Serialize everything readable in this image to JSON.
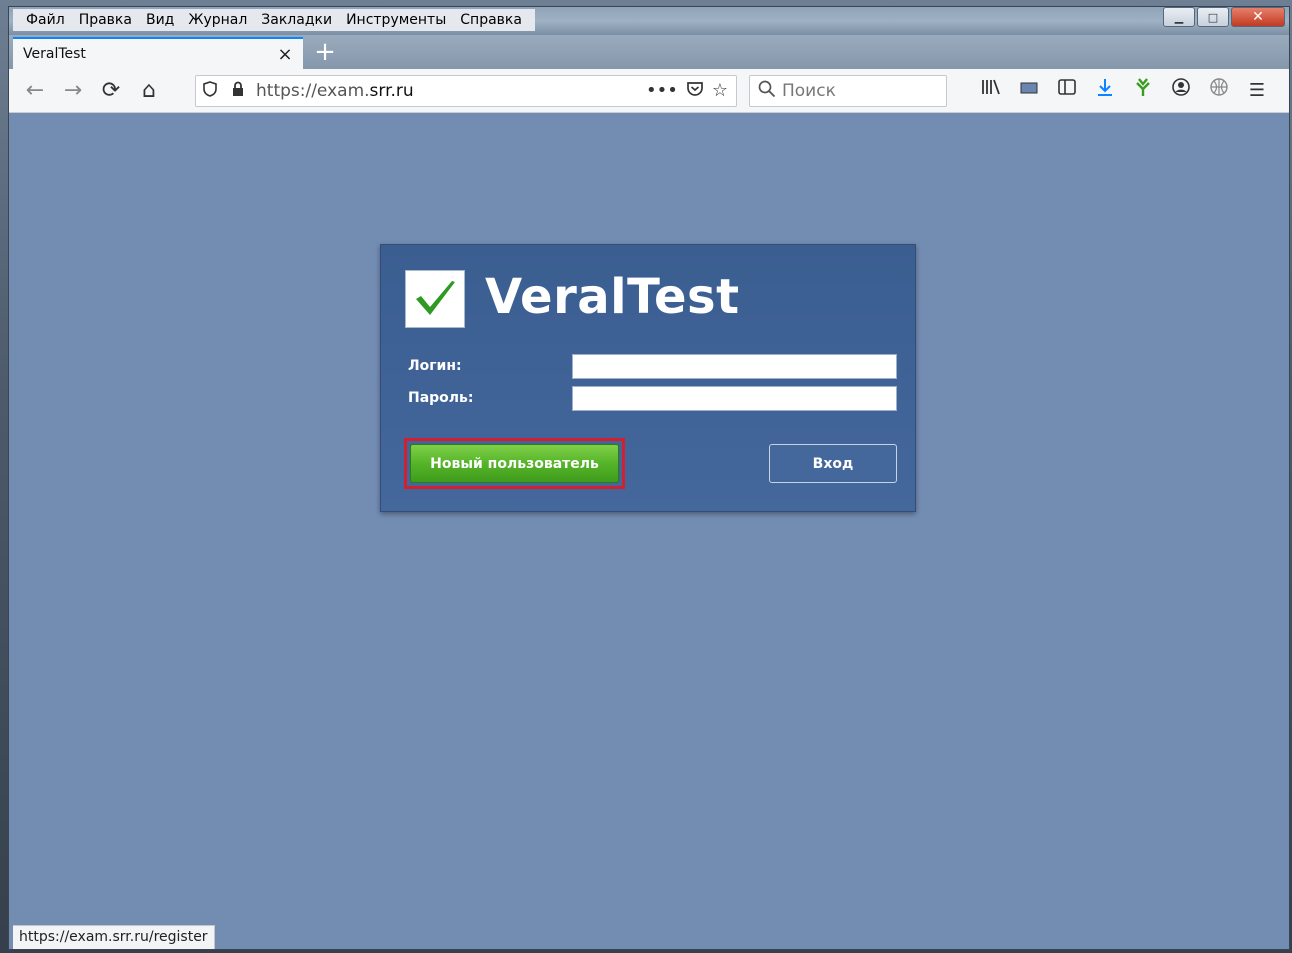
{
  "menu": [
    "Файл",
    "Правка",
    "Вид",
    "Журнал",
    "Закладки",
    "Инструменты",
    "Справка"
  ],
  "tab": {
    "title": "VeralTest",
    "close": "×",
    "new_tab": "+"
  },
  "nav": {
    "back": "←",
    "forward": "→",
    "reload": "⟳",
    "home": "⌂"
  },
  "url": {
    "prefix": "https://exam.",
    "host": "srr.ru",
    "more": "•••"
  },
  "search": {
    "placeholder": "Поиск"
  },
  "app": {
    "logo_text": "VeralTest",
    "login_label": "Логин:",
    "password_label": "Пароль:",
    "login_value": "",
    "password_value": "",
    "new_user_button": "Новый пользователь",
    "login_button": "Вход"
  },
  "status": {
    "link": "https://exam.srr.ru/register"
  },
  "colors": {
    "page_bg": "#738cb2",
    "panel_bg": "#44679c",
    "accent_green": "#55b428",
    "highlight": "#d1202f"
  }
}
